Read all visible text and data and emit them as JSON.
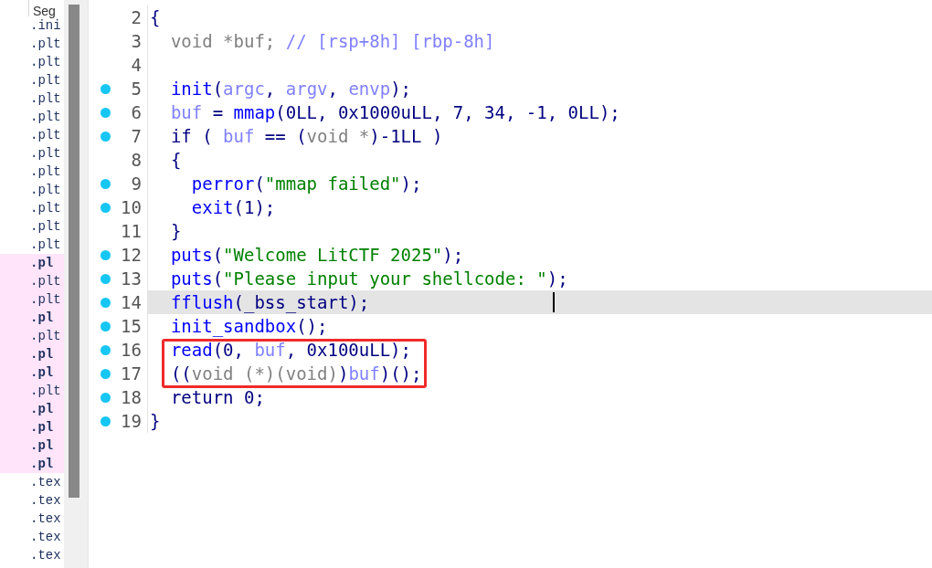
{
  "segments": {
    "header": "Seg",
    "rows": [
      {
        "text": ".ini",
        "bold": false,
        "highlighted": false
      },
      {
        "text": ".plt",
        "bold": false,
        "highlighted": false
      },
      {
        "text": ".plt",
        "bold": false,
        "highlighted": false
      },
      {
        "text": ".plt",
        "bold": false,
        "highlighted": false
      },
      {
        "text": ".plt",
        "bold": false,
        "highlighted": false
      },
      {
        "text": ".plt",
        "bold": false,
        "highlighted": false
      },
      {
        "text": ".plt",
        "bold": false,
        "highlighted": false
      },
      {
        "text": ".plt",
        "bold": false,
        "highlighted": false
      },
      {
        "text": ".plt",
        "bold": false,
        "highlighted": false
      },
      {
        "text": ".plt",
        "bold": false,
        "highlighted": false
      },
      {
        "text": ".plt",
        "bold": false,
        "highlighted": false
      },
      {
        "text": ".plt",
        "bold": false,
        "highlighted": false
      },
      {
        "text": ".plt",
        "bold": false,
        "highlighted": false
      },
      {
        "text": ".pl",
        "bold": true,
        "highlighted": true
      },
      {
        "text": ".plt",
        "bold": false,
        "highlighted": true
      },
      {
        "text": ".plt",
        "bold": false,
        "highlighted": true
      },
      {
        "text": ".pl",
        "bold": true,
        "highlighted": true
      },
      {
        "text": ".plt",
        "bold": false,
        "highlighted": true
      },
      {
        "text": ".pl",
        "bold": true,
        "highlighted": true
      },
      {
        "text": ".pl",
        "bold": true,
        "highlighted": true
      },
      {
        "text": ".plt",
        "bold": false,
        "highlighted": true
      },
      {
        "text": ".pl",
        "bold": true,
        "highlighted": true
      },
      {
        "text": ".pl",
        "bold": true,
        "highlighted": true
      },
      {
        "text": ".pl",
        "bold": true,
        "highlighted": true
      },
      {
        "text": ".pl",
        "bold": true,
        "highlighted": true
      },
      {
        "text": ".tex",
        "bold": false,
        "highlighted": false
      },
      {
        "text": ".tex",
        "bold": false,
        "highlighted": false
      },
      {
        "text": ".tex",
        "bold": false,
        "highlighted": false
      },
      {
        "text": ".tex",
        "bold": false,
        "highlighted": false
      },
      {
        "text": ".tex",
        "bold": false,
        "highlighted": false
      }
    ]
  },
  "code": {
    "lines": [
      {
        "number": "2",
        "tokens": [
          {
            "kind": "plain",
            "text": "{"
          }
        ]
      },
      {
        "number": "3",
        "tokens": [
          {
            "kind": "type",
            "text": "  void *buf; "
          },
          {
            "kind": "comment",
            "text": "// [rsp+8h] [rbp-8h]"
          }
        ]
      },
      {
        "number": "4"
      },
      {
        "number": "5",
        "dot": true,
        "tokens": [
          {
            "kind": "func",
            "text": "  init"
          },
          {
            "kind": "plain",
            "text": "("
          },
          {
            "kind": "var",
            "text": "argc"
          },
          {
            "kind": "plain",
            "text": ", "
          },
          {
            "kind": "var",
            "text": "argv"
          },
          {
            "kind": "plain",
            "text": ", "
          },
          {
            "kind": "var",
            "text": "envp"
          },
          {
            "kind": "plain",
            "text": ");"
          }
        ]
      },
      {
        "number": "6",
        "dot": true,
        "tokens": [
          {
            "kind": "var",
            "text": "  buf"
          },
          {
            "kind": "plain",
            "text": " = "
          },
          {
            "kind": "func",
            "text": "mmap"
          },
          {
            "kind": "plain",
            "text": "(0LL, 0x1000uLL, 7, 34, -1, 0LL);"
          }
        ]
      },
      {
        "number": "7",
        "dot": true,
        "tokens": [
          {
            "kind": "plain",
            "text": "  if ( "
          },
          {
            "kind": "var",
            "text": "buf"
          },
          {
            "kind": "plain",
            "text": " == ("
          },
          {
            "kind": "type",
            "text": "void *"
          },
          {
            "kind": "plain",
            "text": ")-1LL )"
          }
        ]
      },
      {
        "number": "8",
        "tokens": [
          {
            "kind": "plain",
            "text": "  {"
          }
        ]
      },
      {
        "number": "9",
        "dot": true,
        "tokens": [
          {
            "kind": "func",
            "text": "    perror"
          },
          {
            "kind": "plain",
            "text": "("
          },
          {
            "kind": "string",
            "text": "\"mmap failed\""
          },
          {
            "kind": "plain",
            "text": ");"
          }
        ]
      },
      {
        "number": "10",
        "dot": true,
        "tokens": [
          {
            "kind": "func",
            "text": "    exit"
          },
          {
            "kind": "plain",
            "text": "(1);"
          }
        ]
      },
      {
        "number": "11",
        "tokens": [
          {
            "kind": "plain",
            "text": "  }"
          }
        ]
      },
      {
        "number": "12",
        "dot": true,
        "tokens": [
          {
            "kind": "func",
            "text": "  puts"
          },
          {
            "kind": "plain",
            "text": "("
          },
          {
            "kind": "string",
            "text": "\"Welcome LitCTF 2025\""
          },
          {
            "kind": "plain",
            "text": ");"
          }
        ]
      },
      {
        "number": "13",
        "dot": true,
        "tokens": [
          {
            "kind": "func",
            "text": "  puts"
          },
          {
            "kind": "plain",
            "text": "("
          },
          {
            "kind": "string",
            "text": "\"Please input your shellcode: \""
          },
          {
            "kind": "plain",
            "text": ");"
          }
        ]
      },
      {
        "number": "14",
        "dot": true,
        "current": true,
        "tokens": [
          {
            "kind": "func",
            "text": "  fflush"
          },
          {
            "kind": "plain",
            "text": "("
          },
          {
            "kind": "plain",
            "text": "_bss_start"
          },
          {
            "kind": "plain",
            "text": ");"
          }
        ]
      },
      {
        "number": "15",
        "dot": true,
        "tokens": [
          {
            "kind": "func",
            "text": "  init_sandbox"
          },
          {
            "kind": "plain",
            "text": "();"
          }
        ]
      },
      {
        "number": "16",
        "dot": true,
        "boxed": true,
        "tokens": [
          {
            "kind": "func",
            "text": "  read"
          },
          {
            "kind": "plain",
            "text": "(0, "
          },
          {
            "kind": "var",
            "text": "buf"
          },
          {
            "kind": "plain",
            "text": ", 0x100uLL);"
          }
        ]
      },
      {
        "number": "17",
        "dot": true,
        "boxed": true,
        "tokens": [
          {
            "kind": "plain",
            "text": "  (("
          },
          {
            "kind": "type",
            "text": "void (*)(void)"
          },
          {
            "kind": "plain",
            "text": ")"
          },
          {
            "kind": "var",
            "text": "buf"
          },
          {
            "kind": "plain",
            "text": ")();"
          }
        ]
      },
      {
        "number": "18",
        "dot": true,
        "tokens": [
          {
            "kind": "plain",
            "text": "  return 0;"
          }
        ]
      },
      {
        "number": "19",
        "dot": true,
        "tokens": [
          {
            "kind": "plain",
            "text": "}"
          }
        ]
      }
    ]
  }
}
